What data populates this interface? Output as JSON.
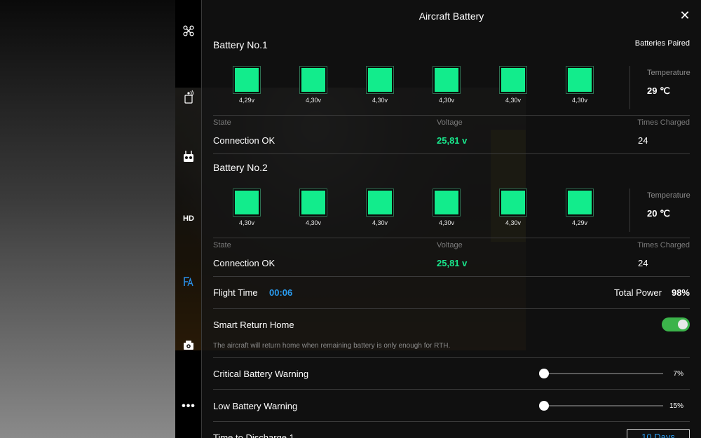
{
  "header": {
    "title": "Aircraft Battery",
    "close_icon": "close-icon"
  },
  "sidebar": {
    "icons": [
      {
        "name": "aircraft-icon"
      },
      {
        "name": "signal-icon"
      },
      {
        "name": "remote-controller-icon"
      },
      {
        "name": "hd-label",
        "label": "HD"
      },
      {
        "name": "battery-icon",
        "active": true
      },
      {
        "name": "camera-icon"
      },
      {
        "name": "more-icon"
      }
    ]
  },
  "paired_status": "Batteries Paired",
  "batteries": [
    {
      "title": "Battery No.1",
      "cells": [
        "4,29v",
        "4,30v",
        "4,30v",
        "4,30v",
        "4,30v",
        "4,30v"
      ],
      "temperature_label": "Temperature",
      "temperature": "29 ℃",
      "state_label": "State",
      "state": "Connection OK",
      "voltage_label": "Voltage",
      "voltage": "25,81 v",
      "times_charged_label": "Times Charged",
      "times_charged": "24"
    },
    {
      "title": "Battery No.2",
      "cells": [
        "4,30v",
        "4,30v",
        "4,30v",
        "4,30v",
        "4,30v",
        "4,29v"
      ],
      "temperature_label": "Temperature",
      "temperature": "20 ℃",
      "state_label": "State",
      "state": "Connection OK",
      "voltage_label": "Voltage",
      "voltage": "25,81 v",
      "times_charged_label": "Times Charged",
      "times_charged": "24"
    }
  ],
  "flight": {
    "time_label": "Flight Time",
    "time": "00:06",
    "power_label": "Total Power",
    "power": "98%"
  },
  "smart_rth": {
    "label": "Smart Return Home",
    "enabled": true,
    "description": "The aircraft will return home when remaining battery is only enough for RTH."
  },
  "critical_warning": {
    "label": "Critical Battery Warning",
    "value": "7%",
    "fraction": 0.0
  },
  "low_warning": {
    "label": "Low Battery Warning",
    "value": "15%",
    "fraction": 0.0
  },
  "discharge": {
    "label": "Time to Discharge 1",
    "value": "10 Days"
  },
  "colors": {
    "cell": "#12ec8c",
    "accent": "#2a9cf0",
    "toggle_on": "#3bb34a"
  }
}
